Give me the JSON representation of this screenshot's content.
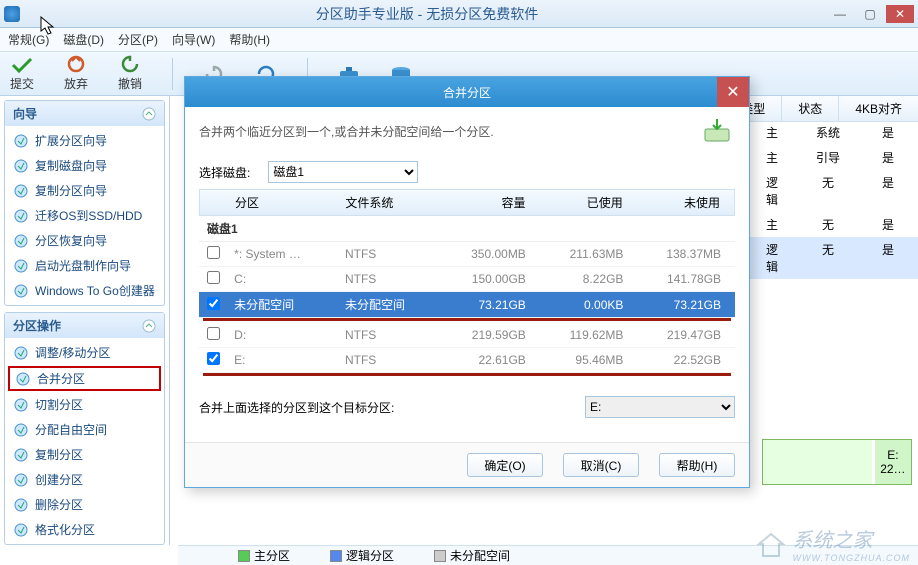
{
  "window": {
    "title": "分区助手专业版 - 无损分区免费软件",
    "min": "—",
    "max": "▢",
    "close": "✕"
  },
  "menu": {
    "general": "常规(G)",
    "disk": "磁盘(D)",
    "partition": "分区(P)",
    "wizard": "向导(W)",
    "help": "帮助(H)"
  },
  "toolbar": {
    "commit": "提交",
    "discard": "放弃",
    "undo": "撤销",
    "redo": "",
    "refresh": "",
    "wizard": "",
    "disk": ""
  },
  "sidebar": {
    "wizard_title": "向导",
    "wizard_items": [
      "扩展分区向导",
      "复制磁盘向导",
      "复制分区向导",
      "迁移OS到SSD/HDD",
      "分区恢复向导",
      "启动光盘制作向导",
      "Windows To Go创建器"
    ],
    "ops_title": "分区操作",
    "ops_items": [
      "调整/移动分区",
      "合并分区",
      "切割分区",
      "分配自由空间",
      "复制分区",
      "创建分区",
      "删除分区",
      "格式化分区"
    ]
  },
  "main_grid": {
    "headers": [
      "类型",
      "状态",
      "4KB对齐"
    ],
    "rows": [
      [
        "主",
        "系统",
        "是"
      ],
      [
        "主",
        "引导",
        "是"
      ],
      [
        "逻辑",
        "无",
        "是"
      ],
      [
        "主",
        "无",
        "是"
      ],
      [
        "逻辑",
        "无",
        "是"
      ]
    ]
  },
  "legend": {
    "primary": "主分区",
    "logical": "逻辑分区",
    "unalloc": "未分配空间"
  },
  "strip": {
    "label": "E:",
    "size": "22…"
  },
  "watermark": "系统之家",
  "watermark_url": "WWW.TONGZHUA.COM",
  "dialog": {
    "title": "合并分区",
    "desc": "合并两个临近分区到一个,或合并未分配空间给一个分区.",
    "select_disk_label": "选择磁盘:",
    "select_disk_value": "磁盘1",
    "headers": {
      "part": "分区",
      "fs": "文件系统",
      "cap": "容量",
      "used": "已使用",
      "free": "未使用"
    },
    "group": "磁盘1",
    "rows": [
      {
        "chk": false,
        "name": "*: System …",
        "fs": "NTFS",
        "cap": "350.00MB",
        "used": "211.63MB",
        "free": "138.37MB",
        "sel": false
      },
      {
        "chk": false,
        "name": "C:",
        "fs": "NTFS",
        "cap": "150.00GB",
        "used": "8.22GB",
        "free": "141.78GB",
        "sel": false
      },
      {
        "chk": true,
        "name": "未分配空间",
        "fs": "未分配空间",
        "cap": "73.21GB",
        "used": "0.00KB",
        "free": "73.21GB",
        "sel": true
      },
      {
        "chk": false,
        "name": "D:",
        "fs": "NTFS",
        "cap": "219.59GB",
        "used": "119.62MB",
        "free": "219.47GB",
        "sel": false
      },
      {
        "chk": true,
        "name": "E:",
        "fs": "NTFS",
        "cap": "22.61GB",
        "used": "95.46MB",
        "free": "22.52GB",
        "sel": false
      }
    ],
    "target_label": "合并上面选择的分区到这个目标分区:",
    "target_value": "E:",
    "ok": "确定(O)",
    "cancel": "取消(C)",
    "help": "帮助(H)"
  }
}
